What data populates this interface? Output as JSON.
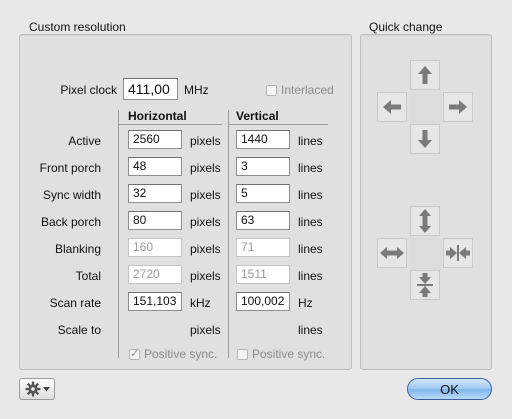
{
  "custom_resolution": {
    "title": "Custom resolution",
    "pixel_clock": {
      "label": "Pixel clock",
      "value": "411,00",
      "unit": "MHz"
    },
    "interlaced": {
      "label": "Interlaced",
      "checked": false
    },
    "columns": {
      "horizontal": "Horizontal",
      "vertical": "Vertical"
    },
    "rows": [
      {
        "label": "Active",
        "h": "2560",
        "h_unit": "pixels",
        "v": "1440",
        "v_unit": "lines",
        "editable": true
      },
      {
        "label": "Front porch",
        "h": "48",
        "h_unit": "pixels",
        "v": "3",
        "v_unit": "lines",
        "editable": true
      },
      {
        "label": "Sync width",
        "h": "32",
        "h_unit": "pixels",
        "v": "5",
        "v_unit": "lines",
        "editable": true
      },
      {
        "label": "Back porch",
        "h": "80",
        "h_unit": "pixels",
        "v": "63",
        "v_unit": "lines",
        "editable": true
      },
      {
        "label": "Blanking",
        "h": "160",
        "h_unit": "pixels",
        "v": "71",
        "v_unit": "lines",
        "editable": false
      },
      {
        "label": "Total",
        "h": "2720",
        "h_unit": "pixels",
        "v": "1511",
        "v_unit": "lines",
        "editable": false
      },
      {
        "label": "Scan rate",
        "h": "151,103",
        "h_unit": "kHz",
        "v": "100,002",
        "v_unit": "Hz",
        "editable": true
      },
      {
        "label": "Scale to",
        "h_unit": "pixels",
        "v_unit": "lines"
      }
    ],
    "positive_sync_h": {
      "label": "Positive sync.",
      "checked": true
    },
    "positive_sync_v": {
      "label": "Positive sync.",
      "checked": false
    }
  },
  "quick_change": {
    "title": "Quick change"
  },
  "footer": {
    "ok_label": "OK",
    "gear_icon": "gear-icon"
  }
}
